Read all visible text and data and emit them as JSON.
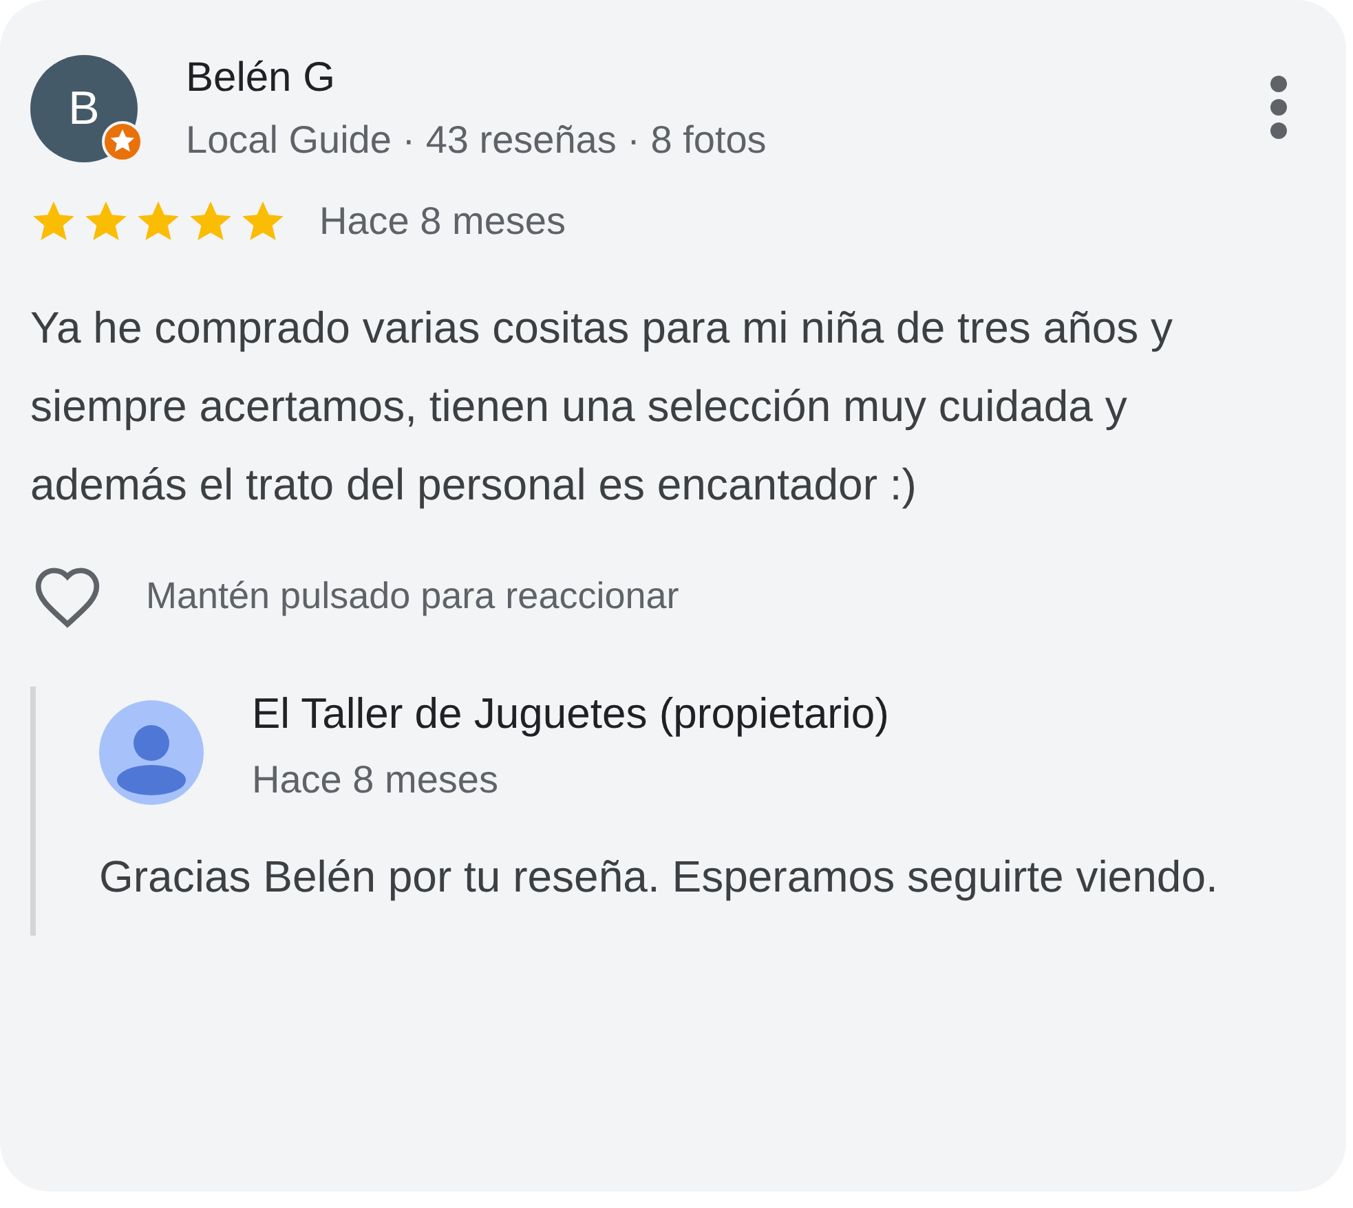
{
  "review": {
    "author": {
      "initial": "B",
      "name": "Belén G",
      "local_guide": true,
      "meta": "Local Guide · 43 reseñas · 8 fotos"
    },
    "stars": 5,
    "time": "Hace 8 meses",
    "text": "Ya he comprado varias cositas para mi niña de tres años y siempre acertamos, tienen una selección muy cuidada y además el trato del personal es encantador :)",
    "react_hint": "Mantén pulsado para reaccionar"
  },
  "owner_reply": {
    "name": "El Taller de Juguetes (propietario)",
    "time": "Hace 8 meses",
    "text": "Gracias Belén por tu reseña. Esperamos seguirte viendo."
  }
}
